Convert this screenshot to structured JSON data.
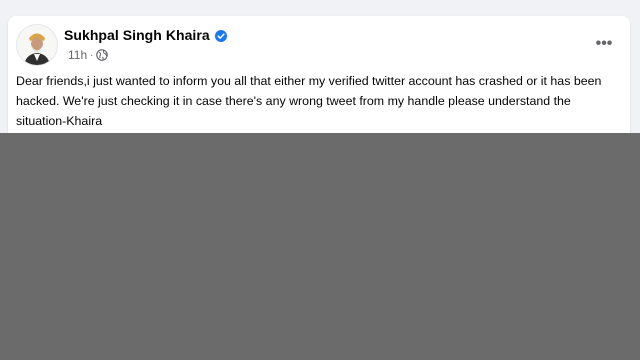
{
  "post": {
    "author": "Sukhpal Singh Khaira",
    "verified": true,
    "time": "11h",
    "audience_icon": "globe-icon",
    "more_icon": "more-options-icon",
    "more_label": "•••",
    "text": "Dear friends,i just wanted to inform you all that either my verified twitter account has crashed or it has been hacked. We're just checking it in case there's any wrong tweet from my handle please understand the situation-Khaira"
  },
  "colors": {
    "page_background": "#f0f2f5",
    "card_background": "#ffffff",
    "verified_blue": "#1877f2",
    "secondary_text": "#65676b",
    "overlay_gray": "#6b6b6b"
  }
}
